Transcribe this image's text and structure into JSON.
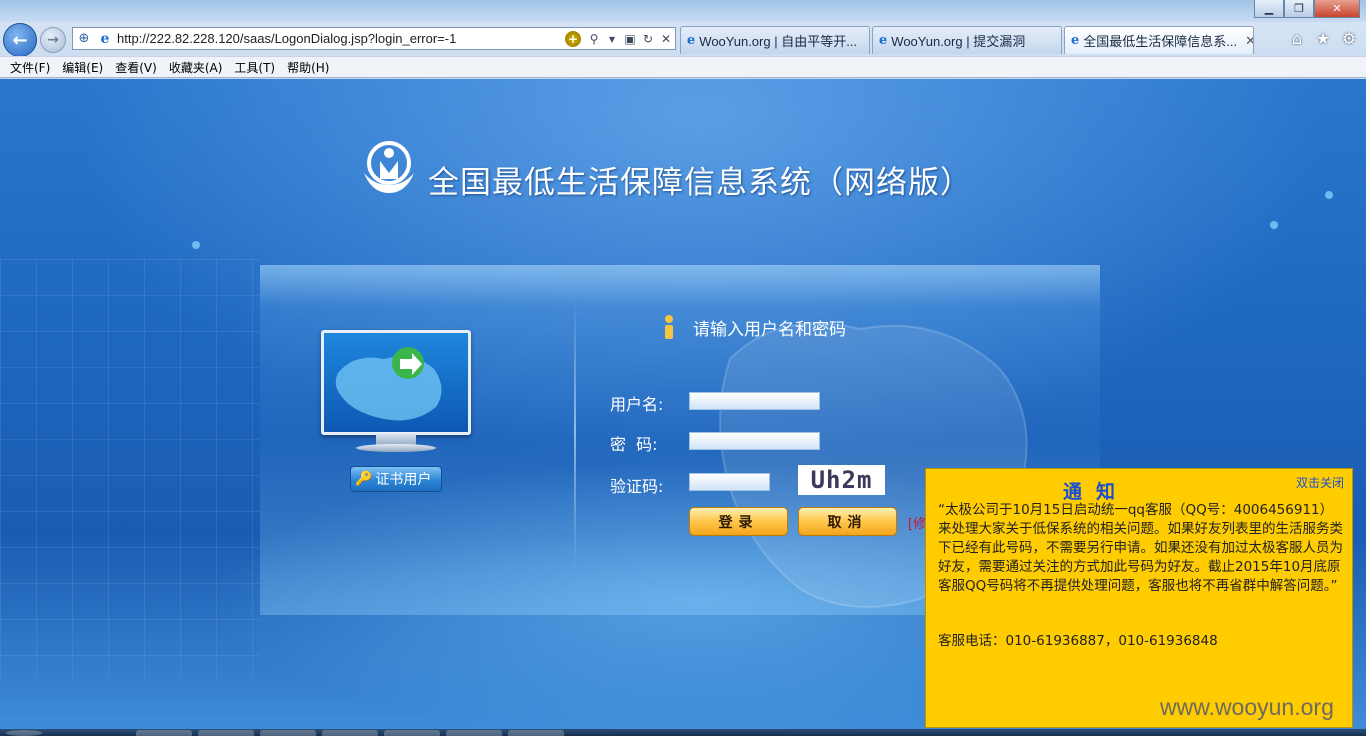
{
  "browser": {
    "address_url": "http://222.82.228.120/saas/LogonDialog.jsp?login_error=-1",
    "tabs": [
      {
        "label": "WooYun.org | 自由平等开...",
        "active": false
      },
      {
        "label": "WooYun.org | 提交漏洞",
        "active": false
      },
      {
        "label": "全国最低生活保障信息系...",
        "active": true
      }
    ],
    "window_controls": {
      "minimize": "▁",
      "restore": "❐",
      "close": "✕"
    },
    "icons": {
      "back": "back-arrow-icon",
      "forward": "forward-arrow-icon",
      "home": "home-icon",
      "favorites": "star-icon",
      "tools": "gear-icon"
    }
  },
  "menu": [
    {
      "label": "文件(F)"
    },
    {
      "label": "编辑(E)"
    },
    {
      "label": "查看(V)"
    },
    {
      "label": "收藏夹(A)"
    },
    {
      "label": "工具(T)"
    },
    {
      "label": "帮助(H)"
    }
  ],
  "page": {
    "system_title": "全国最低生活保障信息系统（网络版）",
    "prompt": "请输入用户名和密码",
    "cert_button_label": "证书用户",
    "form": {
      "username_label": "用户名:",
      "password_label": "密  码:",
      "captcha_label": "验证码:",
      "username_value": "",
      "password_value": "",
      "captcha_value": "",
      "captcha_image_text": "Uh2m",
      "login_button": "登录",
      "cancel_button": "取消",
      "change_link": "[修"
    }
  },
  "notice": {
    "title": "通知",
    "close_label": "双击关闭",
    "body": "“太极公司于10月15日启动统一qq客服（QQ号：4006456911）来处理大家关于低保系统的相关问题。如果好友列表里的生活服务类下已经有此号码，不需要另行申请。如果还没有加过太极客服人员为好友，需要通过关注的方式加此号码为好友。截止2015年10月底原客服QQ号码将不再提供处理问题，客服也将不再省群中解答问题。”",
    "phone": "客服电话：010-61936887，010-61936848"
  },
  "watermark": "www.wooyun.org",
  "colors": {
    "notice_bg": "#ffcc00",
    "notice_title": "#1a4fd1",
    "page_blue": "#1e67c0",
    "button_orange": "#ffc64a"
  }
}
